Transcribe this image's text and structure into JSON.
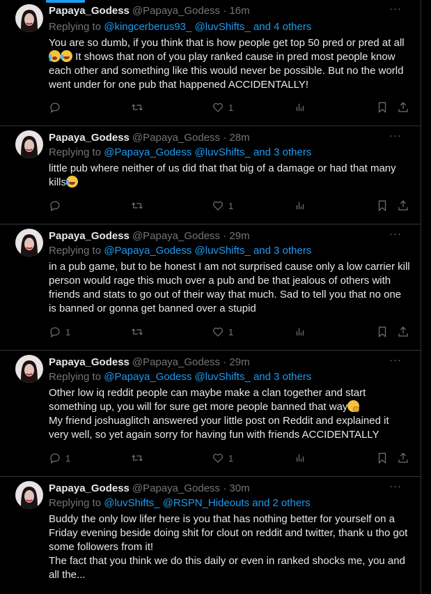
{
  "author": {
    "name": "Papaya_Godess",
    "handle": "@Papaya_Godess"
  },
  "icons": [
    "reply-icon",
    "retweet-icon",
    "like-icon",
    "views-icon",
    "bookmark-icon",
    "share-icon",
    "more-icon"
  ],
  "colors": {
    "link": "#1d9bf0",
    "muted": "#71767b",
    "text": "#e7e9ea",
    "background": "#000000"
  },
  "tweets": [
    {
      "time": "· 16m",
      "replying_prefix": "Replying to ",
      "replying_links": "@kingcerberus93_ @luvShifts_ and 4 others",
      "text_1": "You are so dumb, if you think that is how people get top 50 pred or pred at all",
      "text_2": " It shows that non of you play ranked cause in pred most people know each other and something like this would never be possible. But no the world went under for one pub that happened ACCIDENTALLY!",
      "replies": "",
      "likes": "1"
    },
    {
      "time": "· 28m",
      "replying_prefix": "Replying to ",
      "replying_links": "@Papaya_Godess @luvShifts_ and 3 others",
      "text_1": "little pub where neither of us did that that big of a damage or had that many kills",
      "replies": "",
      "likes": "1"
    },
    {
      "time": "· 29m",
      "replying_prefix": "Replying to ",
      "replying_links": "@Papaya_Godess @luvShifts_ and 3 others",
      "text_1": "in a pub game, but to be honest I am not surprised cause only a low carrier kill person would rage this much over a pub and be that jealous of others with friends and stats to go out of their way that much. Sad to tell you that no one is banned or gonna get banned over a stupid",
      "replies": "1",
      "likes": "1"
    },
    {
      "time": "· 29m",
      "replying_prefix": "Replying to ",
      "replying_links": "@Papaya_Godess @luvShifts_ and 3 others",
      "text_1": "Other low iq reddit people can maybe make a clan together and start something up, you will for sure get more people banned that way",
      "text_2": "My friend joshuaglitch answered your little post on Reddit and explained it very well, so yet again sorry for having fun with friends ACCIDENTALLY",
      "replies": "1",
      "likes": "1"
    },
    {
      "time": "· 30m",
      "replying_prefix": "Replying to ",
      "replying_links": "@luvShifts_ @RSPN_Hideouts and 2 others",
      "text_1": "Buddy the only low lifer here is you that has nothing better for yourself on a Friday evening beside doing shit for clout on reddit and twitter, thank u tho got some followers from it!",
      "text_2": "The fact that you think we do this daily or even in ranked shocks me, you and all the..."
    }
  ]
}
